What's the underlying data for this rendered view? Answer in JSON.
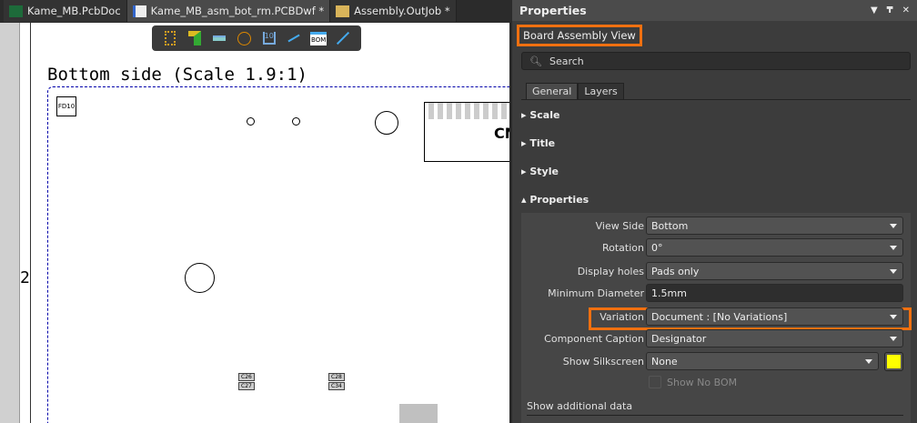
{
  "tabs": [
    {
      "label": "Kame_MB.PcbDoc",
      "icon": "pcb-doc-icon"
    },
    {
      "label": "Kame_MB_asm_bot_rm.PCBDwf *",
      "icon": "draftsman-icon"
    },
    {
      "label": "Assembly.OutJob *",
      "icon": "outjob-folder-icon"
    }
  ],
  "canvas": {
    "title": "Bottom side (Scale 1.9:1)",
    "row_label": "2",
    "fiducial": "FD10",
    "connector": "CN",
    "toolbar": [
      "component-icon",
      "board-outline-icon",
      "board-view-icon",
      "drill-table-icon",
      "layer-stack-icon",
      "dimension-icon",
      "bom-icon",
      "line-icon"
    ],
    "bom_label": "BOM",
    "chips": [
      "C26",
      "C27",
      "C28",
      "C34"
    ]
  },
  "panel": {
    "title": "Properties",
    "object": "Board Assembly View",
    "search_placeholder": "Search",
    "tabs": [
      "General",
      "Layers"
    ],
    "sections": [
      "Scale",
      "Title",
      "Style",
      "Properties"
    ],
    "rows": [
      {
        "label": "View Side",
        "value": "Bottom"
      },
      {
        "label": "Rotation",
        "value": "0°"
      },
      {
        "label": "Display holes",
        "value": "Pads only"
      },
      {
        "label": "Minimum Diameter",
        "value": "1.5mm"
      },
      {
        "label": "Variation",
        "value": "Document : [No Variations]"
      },
      {
        "label": "Component Caption",
        "value": "Designator"
      },
      {
        "label": "Show Silkscreen",
        "value": "None"
      }
    ],
    "silk_color": "#ffff00",
    "show_no_bom": "Show No BOM",
    "additional": "Show additional data"
  }
}
